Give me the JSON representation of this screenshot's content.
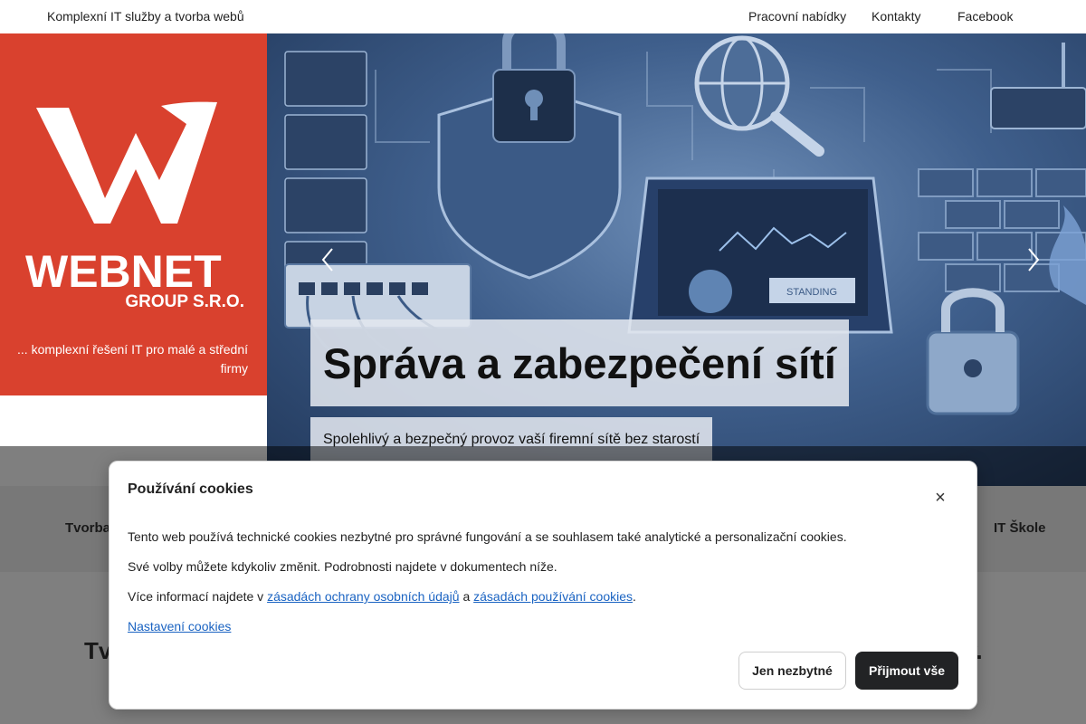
{
  "topbar": {
    "tagline": "Komplexní IT služby a tvorba webů",
    "nav": {
      "jobs": "Pracovní nabídky",
      "contacts": "Kontakty",
      "facebook": "Facebook"
    }
  },
  "logo": {
    "name_line1": "WEBNET",
    "name_line2": "GROUP S.R.O.",
    "tagline": "... komplexní řešení IT pro malé a střední firmy",
    "brand_color": "#d9412e"
  },
  "hero": {
    "title": "Správa a zabezpečení sítí",
    "subtitle": "Spolehlivý a bezpečný provoz vaší firemní sítě bez starostí",
    "screen_label": "STANDING",
    "prev_icon": "chevron-left-icon",
    "next_icon": "chevron-right-icon"
  },
  "service_nav": {
    "item_left": "Tvorba",
    "item_right": "IT Škole"
  },
  "content": {
    "heading_left": "Tv",
    "heading_right": "dy."
  },
  "cookie": {
    "title": "Používání cookies",
    "close_icon": "close-icon",
    "text1": "Tento web používá technické cookies nezbytné pro správné fungování a se souhlasem také analytické a personalizační cookies.",
    "text2": "Své volby můžete kdykoliv změnit. Podrobnosti najdete v dokumentech níže.",
    "text3_prefix": "Více informací najdete v ",
    "link_privacy": "zásadách ochrany osobních údajů",
    "text3_mid": " a ",
    "link_cookies": "zásadách používání cookies",
    "text3_suffix": ".",
    "settings_link": "Nastavení cookies",
    "btn_necessary": "Jen nezbytné",
    "btn_accept": "Přijmout vše",
    "accept_color": "#222325",
    "link_color": "#1a63c2"
  }
}
